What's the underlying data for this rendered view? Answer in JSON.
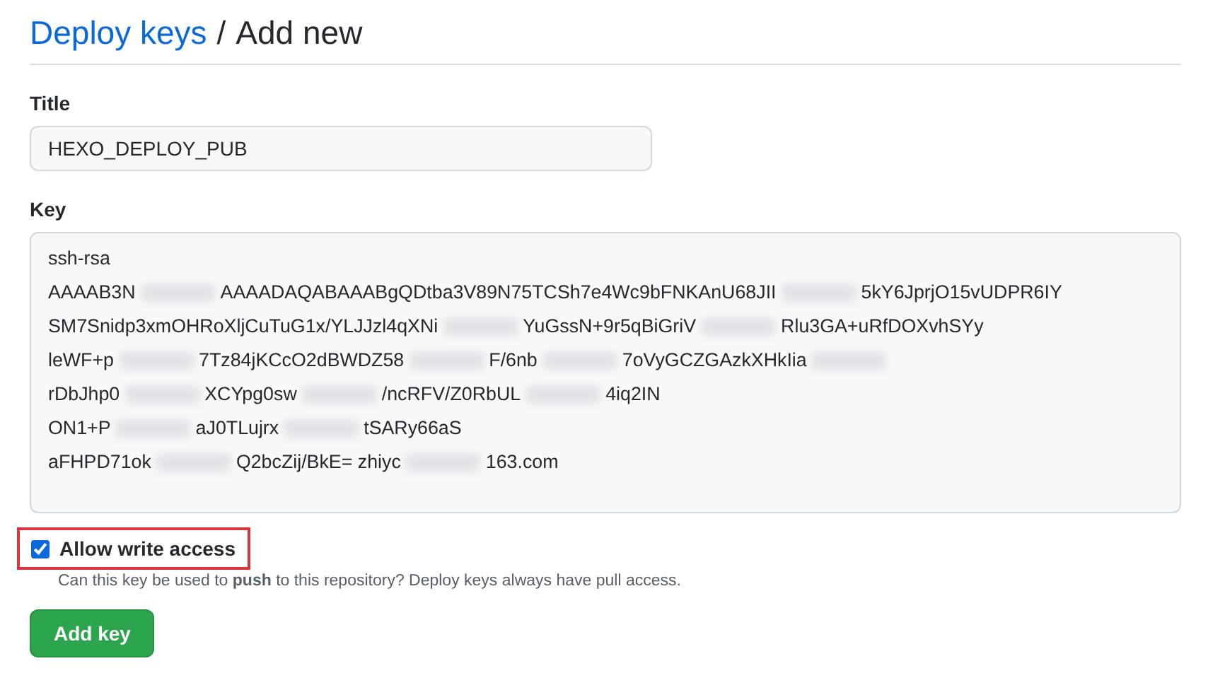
{
  "breadcrumb": {
    "link": "Deploy keys",
    "separator": "/",
    "current": "Add new"
  },
  "title_field": {
    "label": "Title",
    "value": "HEXO_DEPLOY_PUB"
  },
  "key_field": {
    "label": "Key",
    "lines": [
      {
        "parts": [
          "ssh-rsa"
        ]
      },
      {
        "parts": [
          "AAAAB3N",
          "AAAADAQABAAABgQDtba3V89N75TCSh7e4Wc9bFNKAnU68JII",
          "5kY6JprjO15vUDPR6IY"
        ]
      },
      {
        "parts": [
          "SM7Snidp3xmOHRoXljCuTuG1x/YLJJzl4qXNi",
          "YuGssN+9r5qBiGriV",
          "Rlu3GA+uRfDOXvhSYy"
        ]
      },
      {
        "parts": [
          "leWF+p",
          "7Tz84jKCcO2dBWDZ58",
          "F/6nb",
          "7oVyGCZGAzkXHkIia"
        ],
        "blurred_end": true
      },
      {
        "parts": [
          "rDbJhp0",
          "XCYpg0sw",
          "/ncRFV/Z0RbUL",
          "4iq2IN"
        ]
      },
      {
        "parts": [
          "ON1+P",
          "aJ0TLujrx",
          "tSARy66aS"
        ]
      },
      {
        "parts": [
          "aFHPD71ok",
          "Q2bcZij/BkE= zhiyc",
          "163.com"
        ]
      }
    ]
  },
  "write_access": {
    "label": "Allow write access",
    "checked": true,
    "highlighted": true,
    "help": "Can this key be used to **push** to this repository? Deploy keys always have pull access."
  },
  "submit": {
    "label": "Add key"
  }
}
